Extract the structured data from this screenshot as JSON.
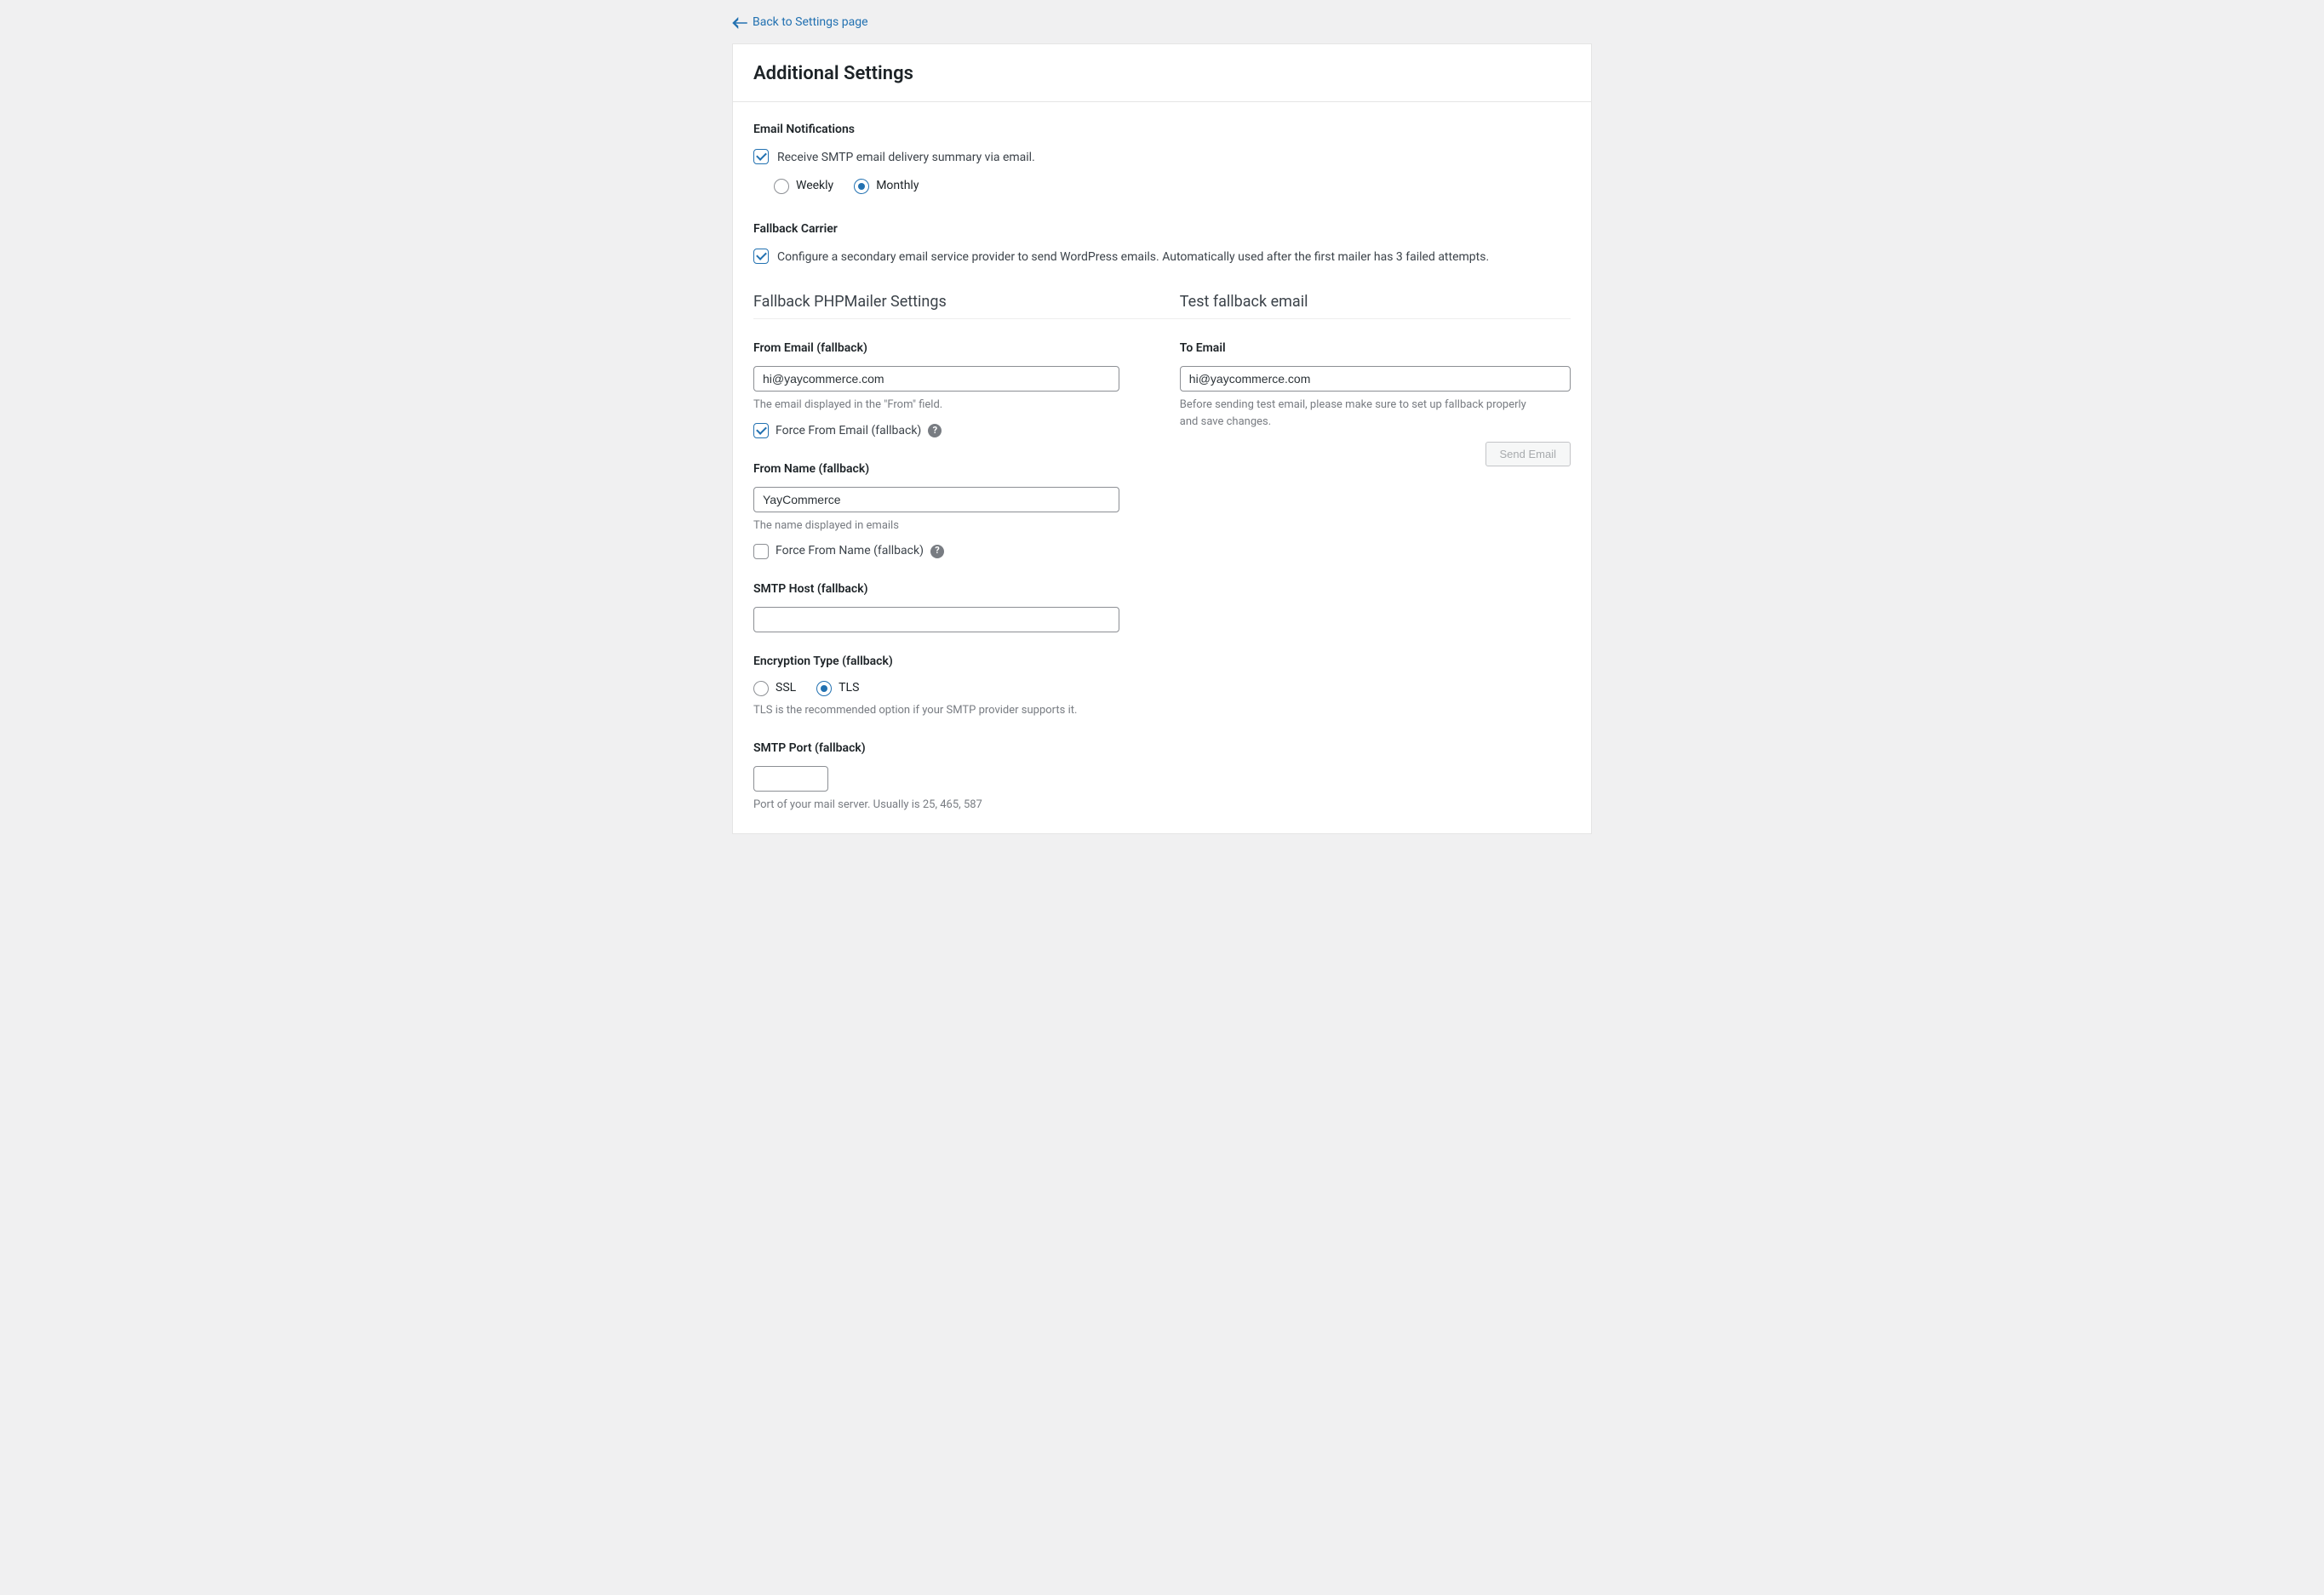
{
  "back_link": "Back to Settings page",
  "page_title": "Additional Settings",
  "sections": {
    "notifications": {
      "title": "Email Notifications",
      "receive_label": "Receive SMTP email delivery summary via email.",
      "receive_checked": true,
      "frequency": {
        "weekly": "Weekly",
        "monthly": "Monthly",
        "selected": "monthly"
      }
    },
    "fallback": {
      "title": "Fallback Carrier",
      "enable_label": "Configure a secondary email service provider to send WordPress emails. Automatically used after the first mailer has 3 failed attempts.",
      "enable_checked": true,
      "left_heading": "Fallback PHPMailer Settings",
      "right_heading": "Test fallback email",
      "from_email": {
        "label": "From Email (fallback)",
        "value": "hi@yaycommerce.com",
        "help": "The email displayed in the \"From\" field.",
        "force_label": "Force From Email (fallback)",
        "force_checked": true
      },
      "from_name": {
        "label": "From Name (fallback)",
        "value": "YayCommerce",
        "help": "The name displayed in emails",
        "force_label": "Force From Name (fallback)",
        "force_checked": false
      },
      "smtp_host": {
        "label": "SMTP Host (fallback)",
        "value": ""
      },
      "encryption": {
        "label": "Encryption Type (fallback)",
        "ssl": "SSL",
        "tls": "TLS",
        "selected": "tls",
        "help": "TLS is the recommended option if your SMTP provider supports it."
      },
      "smtp_port": {
        "label": "SMTP Port (fallback)",
        "value": "",
        "help": "Port of your mail server. Usually is 25, 465, 587"
      },
      "test": {
        "to_label": "To Email",
        "to_value": "hi@yaycommerce.com",
        "help": "Before sending test email, please make sure to set up fallback properly and save changes.",
        "button": "Send Email"
      }
    }
  }
}
